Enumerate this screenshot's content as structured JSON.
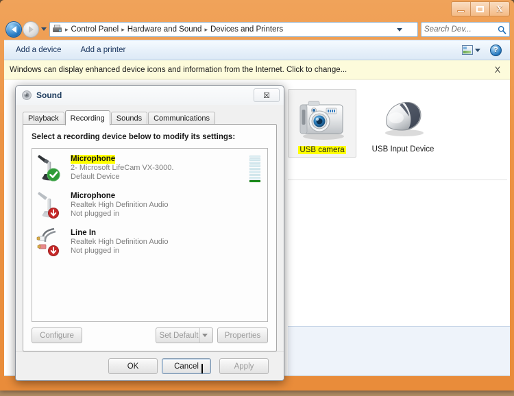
{
  "window": {
    "controls": {
      "minimize": "minimize",
      "maximize": "maximize",
      "close": "X"
    }
  },
  "address": {
    "crumbs": [
      "Control Panel",
      "Hardware and Sound",
      "Devices and Printers"
    ],
    "separator": "▸",
    "icon": "printer-icon"
  },
  "search": {
    "placeholder": "Search Dev...",
    "value": ""
  },
  "toolbar": {
    "items": [
      "Add a device",
      "Add a printer"
    ],
    "help_label": "?"
  },
  "info_bar": {
    "text": "Windows can display enhanced device icons and information from the Internet. Click to change...",
    "close_label": "X"
  },
  "devices": [
    {
      "label": "USB camera",
      "icon": "camera-icon",
      "selected": true,
      "highlighted": true
    },
    {
      "label": "USB Input Device",
      "icon": "mouse-icon",
      "selected": false,
      "highlighted": false
    }
  ],
  "sound_dialog": {
    "title": "Sound",
    "icon": "speaker-icon",
    "close_label": "☒",
    "tabs": [
      {
        "label": "Playback",
        "active": false
      },
      {
        "label": "Recording",
        "active": true
      },
      {
        "label": "Sounds",
        "active": false
      },
      {
        "label": "Communications",
        "active": false
      }
    ],
    "instruction": "Select a recording device below to modify its settings:",
    "recording_devices": [
      {
        "name": "Microphone",
        "driver": "2- Microsoft LifeCam VX-3000.",
        "status": "Default Device",
        "badge": "check-badge",
        "icon": "microphone-icon",
        "highlighted": true,
        "meter_segments": 9,
        "meter_active": 1
      },
      {
        "name": "Microphone",
        "driver": "Realtek High Definition Audio",
        "status": "Not plugged in",
        "badge": "disabled-badge",
        "icon": "microphone-icon",
        "highlighted": false,
        "meter_segments": 0,
        "meter_active": 0
      },
      {
        "name": "Line In",
        "driver": "Realtek High Definition Audio",
        "status": "Not plugged in",
        "badge": "disabled-badge",
        "icon": "rca-cable-icon",
        "highlighted": false,
        "meter_segments": 0,
        "meter_active": 0
      }
    ],
    "panel_buttons": {
      "configure": "Configure",
      "set_default": "Set Default",
      "properties": "Properties"
    },
    "footer_buttons": {
      "ok": "OK",
      "cancel": "Cancel",
      "apply": "Apply"
    }
  },
  "colors": {
    "frame": "#ec9446",
    "highlight": "#ffff00",
    "info_bar": "#fdfbdb",
    "meter_green": "#1a9a1a",
    "details_pane": "#eef3fa"
  }
}
